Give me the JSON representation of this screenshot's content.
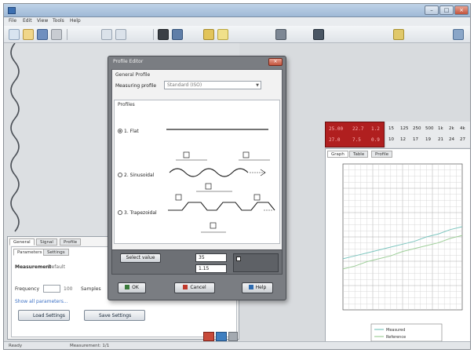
{
  "window": {
    "title": "",
    "icons": {
      "app": "app-icon",
      "minimize": "minimize-icon",
      "maximize": "maximize-icon",
      "close": "close-icon"
    }
  },
  "menu": {
    "items": [
      "File",
      "Edit",
      "View",
      "Tools",
      "Help"
    ]
  },
  "toolbar": {
    "icons": [
      "new-icon",
      "open-icon",
      "save-icon",
      "print-icon",
      "undo-icon",
      "redo-icon",
      "cut-icon",
      "copy-icon",
      "chart-icon",
      "settings-icon",
      "measure-icon",
      "zoom-icon"
    ]
  },
  "properties_panel": {
    "tabs": [
      "General",
      "Signal",
      "Profile"
    ],
    "subtabs": [
      "Parameters",
      "Settings"
    ],
    "fields": [
      {
        "label": "Measurement",
        "value": "Default"
      },
      {
        "label": "Frequency",
        "value": "100"
      },
      {
        "label": "Samples",
        "value": ""
      }
    ],
    "link_text": "Show all parameters...",
    "buttons": [
      "Load Settings",
      "Save Settings"
    ]
  },
  "red_display": {
    "rows": [
      [
        "25.00",
        "22.7",
        "1.2"
      ],
      [
        "27.0",
        "7.5",
        "0.9"
      ]
    ]
  },
  "param_grid": {
    "rows": [
      [
        "15",
        "125",
        "250",
        "500",
        "1k",
        "2k",
        "4k"
      ],
      [
        "10",
        "12",
        "17",
        "19",
        "21",
        "24",
        "27"
      ]
    ]
  },
  "chart": {
    "tabs": [
      "Graph",
      "Table",
      "Profile"
    ],
    "legend": [
      "Measured",
      "Reference"
    ]
  },
  "chart_data": {
    "type": "line",
    "xlabel": "",
    "ylabel": "",
    "grid": true,
    "legend_position": "bottom-right",
    "series": [
      {
        "x": [
          0,
          10,
          20,
          30,
          40,
          50,
          60,
          70,
          80,
          90,
          100
        ],
        "y": [
          35,
          37,
          39,
          41,
          43,
          45,
          47,
          50,
          52,
          55,
          57
        ],
        "color": "#7dc6bf"
      },
      {
        "x": [
          0,
          10,
          20,
          30,
          40,
          50,
          60,
          70,
          80,
          90,
          100
        ],
        "y": [
          28,
          30,
          33,
          35,
          37,
          40,
          42,
          44,
          46,
          49,
          51
        ],
        "color": "#9fcf9a"
      }
    ],
    "xlim": [
      0,
      100
    ],
    "ylim": [
      0,
      100
    ]
  },
  "dialog": {
    "title": "Profile Editor",
    "group_label": "General Profile",
    "select_label": "Measuring profile",
    "select_value": "Standard (ISO)",
    "profiles_label": "Profiles",
    "profiles": [
      {
        "label": "1. Flat",
        "checked": true
      },
      {
        "label": "2. Sinusoidal",
        "checked": false
      },
      {
        "label": "3. Trapezoidal",
        "checked": false
      }
    ],
    "bottom": {
      "dropdown": "Select value",
      "input1": "35",
      "input2": "1.15",
      "checkbox_label": ""
    },
    "footer_buttons": [
      "OK",
      "Cancel",
      "Help"
    ]
  },
  "statusbar": {
    "left": "Ready",
    "mid": "Measurement: 1/1"
  }
}
